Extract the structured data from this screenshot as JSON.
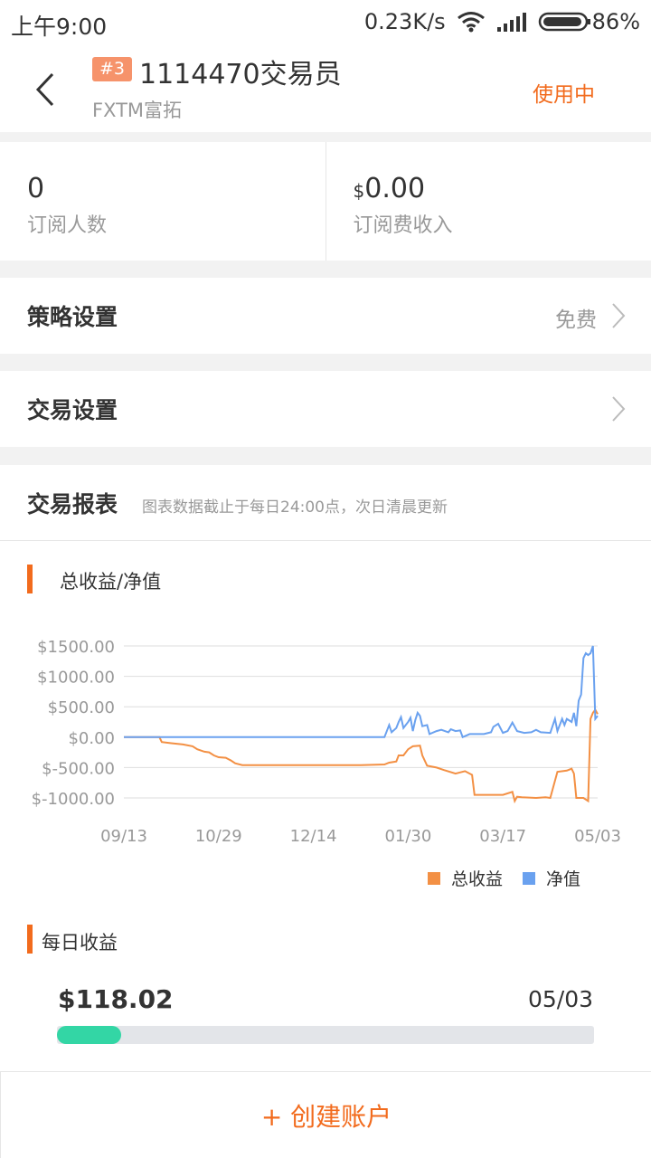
{
  "status_bar": {
    "time": "上午9:00",
    "net_speed": "0.23K/s",
    "battery": "86%"
  },
  "header": {
    "rank": "#3",
    "title": "1114470交易员",
    "broker": "FXTM富拓",
    "status": "使用中"
  },
  "stats": [
    {
      "currency": "",
      "value": "0",
      "label": "订阅人数"
    },
    {
      "currency": "$",
      "value": "0.00",
      "label": "订阅费收入"
    }
  ],
  "strategy": {
    "label": "策略设置",
    "value": "免费"
  },
  "trade_settings": {
    "label": "交易设置"
  },
  "report": {
    "title": "交易报表",
    "note": "图表数据截止于每日24:00点，次日清晨更新",
    "chart_title": "总收益/净值",
    "daily_title": "每日收益",
    "daily_value": "$118.02",
    "daily_date": "05/03",
    "daily_progress": 0.12
  },
  "colors": {
    "accent": "#f26b1d",
    "profit": "#f39044",
    "equity": "#6aa1ef",
    "progress": "#33d6a5"
  },
  "chart_data": {
    "type": "line",
    "x_ticks": [
      "09/13",
      "10/29",
      "12/14",
      "01/30",
      "03/17",
      "05/03"
    ],
    "y_ticks": [
      "$1500.00",
      "$1000.00",
      "$500.00",
      "$0.00",
      "$-500.00",
      "$-1000.00"
    ],
    "ylim": [
      -1000,
      1500
    ],
    "grid": true,
    "legend_position": "bottom-right",
    "series": [
      {
        "name": "总收益",
        "color": "#f39044",
        "points": [
          [
            0,
            0
          ],
          [
            0.075,
            0
          ],
          [
            0.08,
            -80
          ],
          [
            0.1,
            -100
          ],
          [
            0.125,
            -120
          ],
          [
            0.145,
            -150
          ],
          [
            0.155,
            -200
          ],
          [
            0.17,
            -240
          ],
          [
            0.18,
            -250
          ],
          [
            0.19,
            -300
          ],
          [
            0.2,
            -330
          ],
          [
            0.215,
            -340
          ],
          [
            0.225,
            -380
          ],
          [
            0.235,
            -430
          ],
          [
            0.25,
            -460
          ],
          [
            0.3,
            -460
          ],
          [
            0.38,
            -460
          ],
          [
            0.45,
            -460
          ],
          [
            0.5,
            -460
          ],
          [
            0.55,
            -450
          ],
          [
            0.56,
            -420
          ],
          [
            0.575,
            -400
          ],
          [
            0.58,
            -300
          ],
          [
            0.59,
            -300
          ],
          [
            0.6,
            -200
          ],
          [
            0.61,
            -150
          ],
          [
            0.625,
            -140
          ],
          [
            0.63,
            -300
          ],
          [
            0.64,
            -470
          ],
          [
            0.66,
            -500
          ],
          [
            0.675,
            -540
          ],
          [
            0.7,
            -600
          ],
          [
            0.72,
            -560
          ],
          [
            0.735,
            -620
          ],
          [
            0.74,
            -950
          ],
          [
            0.76,
            -950
          ],
          [
            0.8,
            -950
          ],
          [
            0.82,
            -900
          ],
          [
            0.825,
            -1050
          ],
          [
            0.83,
            -980
          ],
          [
            0.84,
            -990
          ],
          [
            0.87,
            -1000
          ],
          [
            0.89,
            -990
          ],
          [
            0.9,
            -1000
          ],
          [
            0.915,
            -570
          ],
          [
            0.935,
            -550
          ],
          [
            0.945,
            -520
          ],
          [
            0.95,
            -600
          ],
          [
            0.955,
            -1000
          ],
          [
            0.97,
            -1000
          ],
          [
            0.98,
            -1050
          ],
          [
            0.985,
            300
          ],
          [
            0.99,
            400
          ],
          [
            0.995,
            450
          ],
          [
            1,
            380
          ]
        ]
      },
      {
        "name": "净值",
        "color": "#6aa1ef",
        "points": [
          [
            0,
            0
          ],
          [
            0.55,
            0
          ],
          [
            0.56,
            200
          ],
          [
            0.565,
            80
          ],
          [
            0.575,
            150
          ],
          [
            0.58,
            250
          ],
          [
            0.585,
            330
          ],
          [
            0.59,
            150
          ],
          [
            0.6,
            250
          ],
          [
            0.605,
            320
          ],
          [
            0.61,
            100
          ],
          [
            0.615,
            280
          ],
          [
            0.62,
            400
          ],
          [
            0.625,
            350
          ],
          [
            0.63,
            180
          ],
          [
            0.64,
            200
          ],
          [
            0.645,
            50
          ],
          [
            0.66,
            100
          ],
          [
            0.67,
            120
          ],
          [
            0.685,
            80
          ],
          [
            0.69,
            130
          ],
          [
            0.7,
            100
          ],
          [
            0.71,
            110
          ],
          [
            0.715,
            0
          ],
          [
            0.73,
            50
          ],
          [
            0.76,
            50
          ],
          [
            0.775,
            80
          ],
          [
            0.78,
            170
          ],
          [
            0.79,
            220
          ],
          [
            0.8,
            70
          ],
          [
            0.81,
            100
          ],
          [
            0.82,
            240
          ],
          [
            0.83,
            100
          ],
          [
            0.845,
            70
          ],
          [
            0.86,
            80
          ],
          [
            0.87,
            120
          ],
          [
            0.88,
            80
          ],
          [
            0.9,
            70
          ],
          [
            0.91,
            300
          ],
          [
            0.915,
            100
          ],
          [
            0.925,
            300
          ],
          [
            0.93,
            200
          ],
          [
            0.935,
            300
          ],
          [
            0.945,
            250
          ],
          [
            0.95,
            400
          ],
          [
            0.955,
            180
          ],
          [
            0.96,
            600
          ],
          [
            0.965,
            700
          ],
          [
            0.97,
            1300
          ],
          [
            0.975,
            1380
          ],
          [
            0.98,
            1350
          ],
          [
            0.985,
            1380
          ],
          [
            0.99,
            1500
          ],
          [
            0.995,
            300
          ],
          [
            1,
            350
          ]
        ]
      }
    ]
  }
}
